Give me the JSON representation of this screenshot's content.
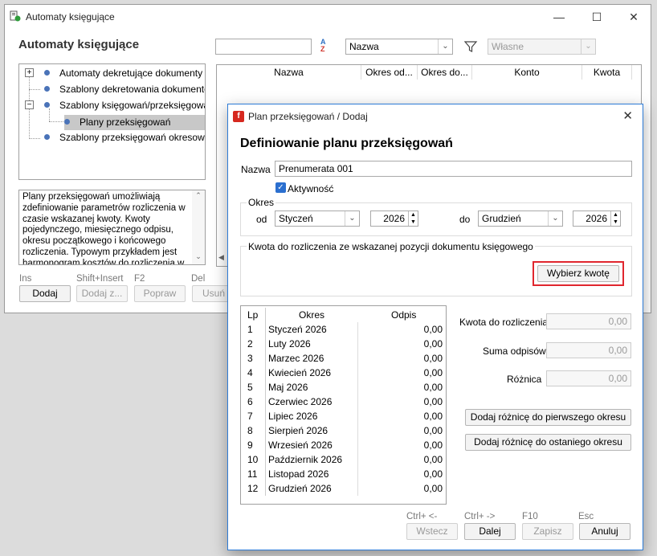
{
  "main": {
    "title": "Automaty księgujące",
    "heading": "Automaty księgujące",
    "search_value": "",
    "sort_field": "Nazwa",
    "filter_value": "Własne",
    "tree": [
      {
        "label": "Automaty dekretujące dokumenty VAT"
      },
      {
        "label": "Szablony dekretowania dokumentów"
      },
      {
        "label": "Szablony księgowań/przeksięgowań"
      },
      {
        "label": "Plany przeksięgowań"
      },
      {
        "label": "Szablony przeksięgowań okresowych"
      }
    ],
    "description": "Plany przeksięgowań umożliwiają zdefiniowanie parametrów rozliczenia w czasie wskazanej kwoty. Kwoty pojedynczego, miesięcznego odpisu, okresu początkowego i końcowego rozliczenia. Typowym przykładem jest harmonogram kosztów do rozliczenia w czasie.",
    "grid_columns": [
      "Nazwa",
      "Okres od...",
      "Okres do...",
      "Konto",
      "Kwota"
    ],
    "actions": [
      {
        "shortcut": "Ins",
        "label": "Dodaj"
      },
      {
        "shortcut": "Shift+Insert",
        "label": "Dodaj z..."
      },
      {
        "shortcut": "F2",
        "label": "Popraw"
      },
      {
        "shortcut": "Del",
        "label": "Usuń"
      }
    ]
  },
  "dialog": {
    "title": "Plan przeksięgowań / Dodaj",
    "heading": "Definiowanie planu przeksięgowań",
    "name_label": "Nazwa",
    "name_value": "Prenumerata 001",
    "active_label": "Aktywność",
    "period_group": "Okres",
    "from_label": "od",
    "from_month": "Styczeń",
    "from_year": "2026",
    "to_label": "do",
    "to_month": "Grudzień",
    "to_year": "2026",
    "amount_group": "Kwota do rozliczenia ze wskazanej pozycji dokumentu księgowego",
    "choose_amount_button": "Wybierz kwotę",
    "table_headers": {
      "lp": "Lp",
      "period": "Okres",
      "amount": "Odpis"
    },
    "rows": [
      {
        "lp": "1",
        "period": "Styczeń 2026",
        "amount": "0,00"
      },
      {
        "lp": "2",
        "period": "Luty 2026",
        "amount": "0,00"
      },
      {
        "lp": "3",
        "period": "Marzec 2026",
        "amount": "0,00"
      },
      {
        "lp": "4",
        "period": "Kwiecień 2026",
        "amount": "0,00"
      },
      {
        "lp": "5",
        "period": "Maj 2026",
        "amount": "0,00"
      },
      {
        "lp": "6",
        "period": "Czerwiec 2026",
        "amount": "0,00"
      },
      {
        "lp": "7",
        "period": "Lipiec 2026",
        "amount": "0,00"
      },
      {
        "lp": "8",
        "period": "Sierpień 2026",
        "amount": "0,00"
      },
      {
        "lp": "9",
        "period": "Wrzesień 2026",
        "amount": "0,00"
      },
      {
        "lp": "10",
        "period": "Październik 2026",
        "amount": "0,00"
      },
      {
        "lp": "11",
        "period": "Listopad 2026",
        "amount": "0,00"
      },
      {
        "lp": "12",
        "period": "Grudzień 2026",
        "amount": "0,00"
      }
    ],
    "amount_to_settle_label": "Kwota do rozliczenia",
    "amount_to_settle_value": "0,00",
    "sum_label": "Suma odpisów",
    "sum_value": "0,00",
    "difference_label": "Różnica",
    "difference_value": "0,00",
    "add_first_button": "Dodaj różnicę do pierwszego okresu",
    "add_last_button": "Dodaj różnicę do ostaniego okresu",
    "footer": [
      {
        "shortcut": "Ctrl+ <-",
        "label": "Wstecz"
      },
      {
        "shortcut": "Ctrl+ ->",
        "label": "Dalej"
      },
      {
        "shortcut": "F10",
        "label": "Zapisz"
      },
      {
        "shortcut": "Esc",
        "label": "Anuluj"
      }
    ]
  }
}
